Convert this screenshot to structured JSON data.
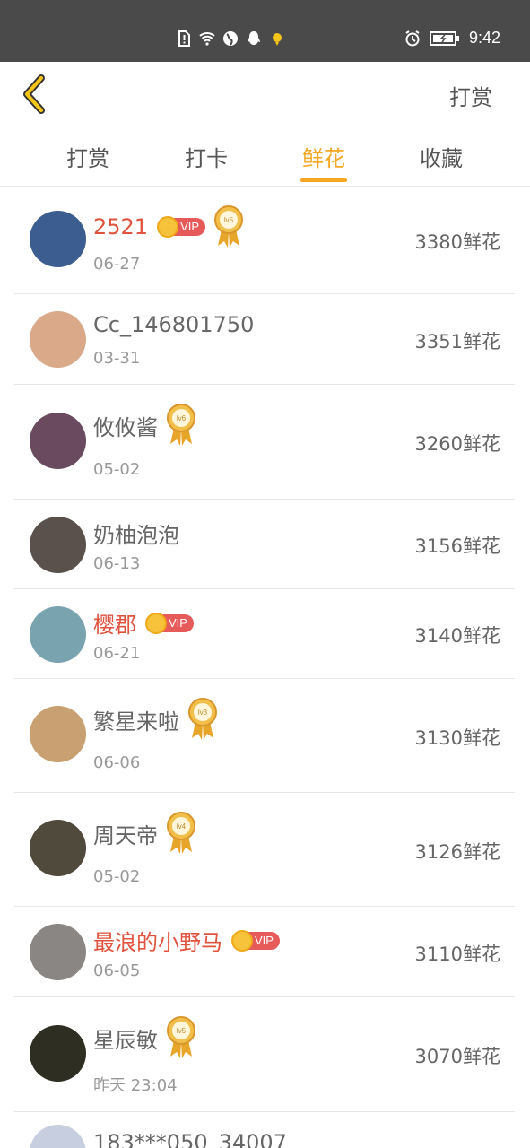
{
  "status_bar": {
    "time": "9:42"
  },
  "header": {
    "action_label": "打赏"
  },
  "tabs": [
    {
      "label": "打赏"
    },
    {
      "label": "打卡"
    },
    {
      "label": "鲜花",
      "active": true
    },
    {
      "label": "收藏"
    }
  ],
  "vip_label": "VIP",
  "rows": [
    {
      "name": "2521",
      "vip": true,
      "level": "lv5",
      "date": "06-27",
      "amount": "3380鲜花",
      "avatar_color": "#3b5d8f"
    },
    {
      "name": "Cc_146801750",
      "vip": false,
      "level": "",
      "date": "03-31",
      "amount": "3351鲜花",
      "avatar_color": "#d9a98a"
    },
    {
      "name": "攸攸酱",
      "vip": false,
      "level": "lv6",
      "date": "05-02",
      "amount": "3260鲜花",
      "avatar_color": "#6a4a5e"
    },
    {
      "name": "奶柚泡泡",
      "vip": false,
      "level": "",
      "date": "06-13",
      "amount": "3156鲜花",
      "avatar_color": "#5a514d"
    },
    {
      "name": "樱郡",
      "vip": true,
      "level": "",
      "date": "06-21",
      "amount": "3140鲜花",
      "avatar_color": "#7aa3b0"
    },
    {
      "name": "繁星来啦",
      "vip": false,
      "level": "lv3",
      "date": "06-06",
      "amount": "3130鲜花",
      "avatar_color": "#c9a071"
    },
    {
      "name": "周天帝",
      "vip": false,
      "level": "lv4",
      "date": "05-02",
      "amount": "3126鲜花",
      "avatar_color": "#4f4a3c"
    },
    {
      "name": "最浪的小野马",
      "vip": true,
      "level": "",
      "date": "06-05",
      "amount": "3110鲜花",
      "avatar_color": "#8a8683"
    },
    {
      "name": "星辰敏",
      "vip": false,
      "level": "lv5",
      "date": "昨天 23:04",
      "amount": "3070鲜花",
      "avatar_color": "#2e2e22"
    },
    {
      "name": "183***050_34007",
      "vip": false,
      "level": "",
      "date": "",
      "amount": "",
      "avatar_color": "#c7cedf"
    }
  ],
  "colors": {
    "accent": "#f5a623",
    "vip_name": "#e0533d",
    "status_bar_bg": "#4a4a4a"
  }
}
